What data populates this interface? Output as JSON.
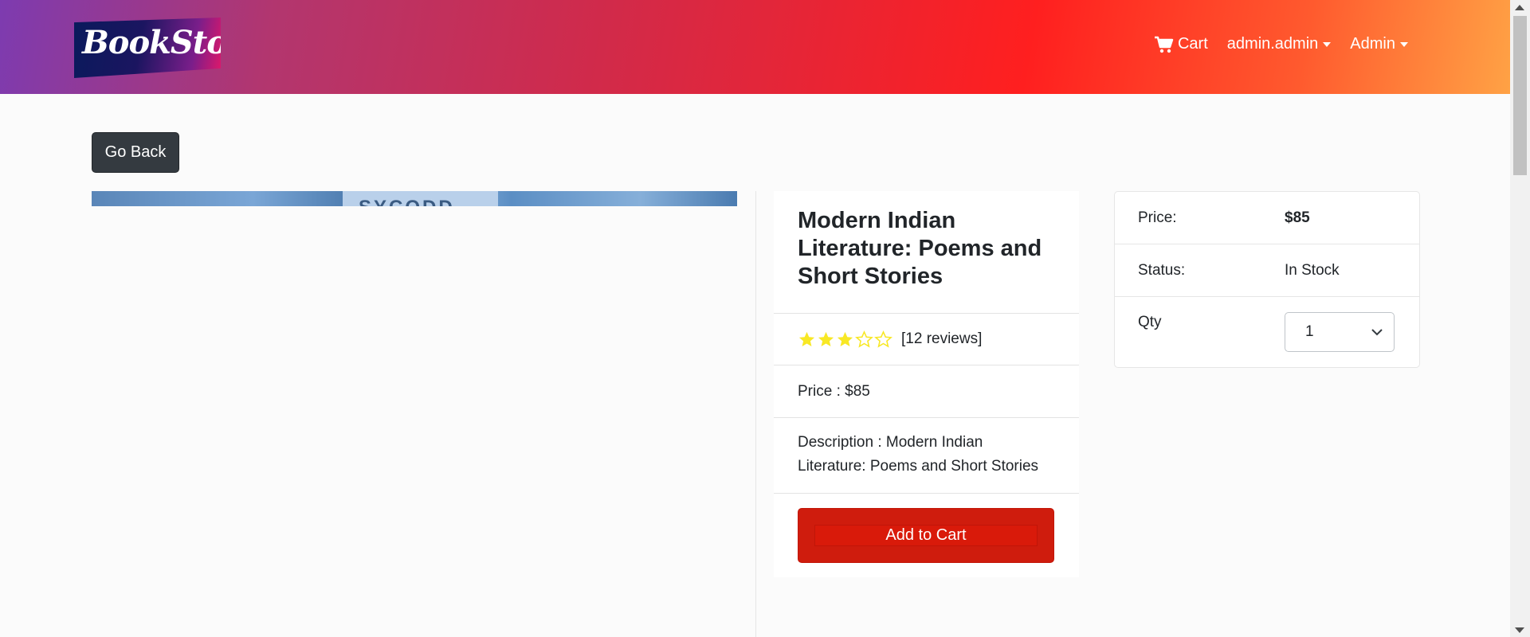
{
  "brand": {
    "logo_text": "BookStore"
  },
  "nav": {
    "cart_label": "Cart",
    "user_label": "admin.admin",
    "admin_label": "Admin"
  },
  "actions": {
    "go_back_label": "Go Back"
  },
  "product": {
    "title": "Modern Indian Literature: Poems and Short Stories",
    "rating": 3,
    "rating_max": 5,
    "reviews_text": "[12 reviews]",
    "price_line": "Price : $85",
    "description_line": "Description : Modern Indian Literature: Poems and Short Stories",
    "add_to_cart_label": "Add to Cart",
    "image_visible_text": "SYCODD"
  },
  "summary": {
    "price_label": "Price:",
    "price_value": "$85",
    "status_label": "Status:",
    "status_value": "In Stock",
    "qty_label": "Qty",
    "qty_value": "1"
  },
  "colors": {
    "navbar_gradient": [
      "#7d3bb0",
      "#d12a4a",
      "#ff1f1f",
      "#ffa245"
    ],
    "add_to_cart": "#d91a0a",
    "go_back": "#343a40",
    "star": "#f8e825"
  },
  "icons": [
    "shopping-cart-icon",
    "caret-down-icon",
    "star-icon",
    "chevron-down-icon"
  ]
}
